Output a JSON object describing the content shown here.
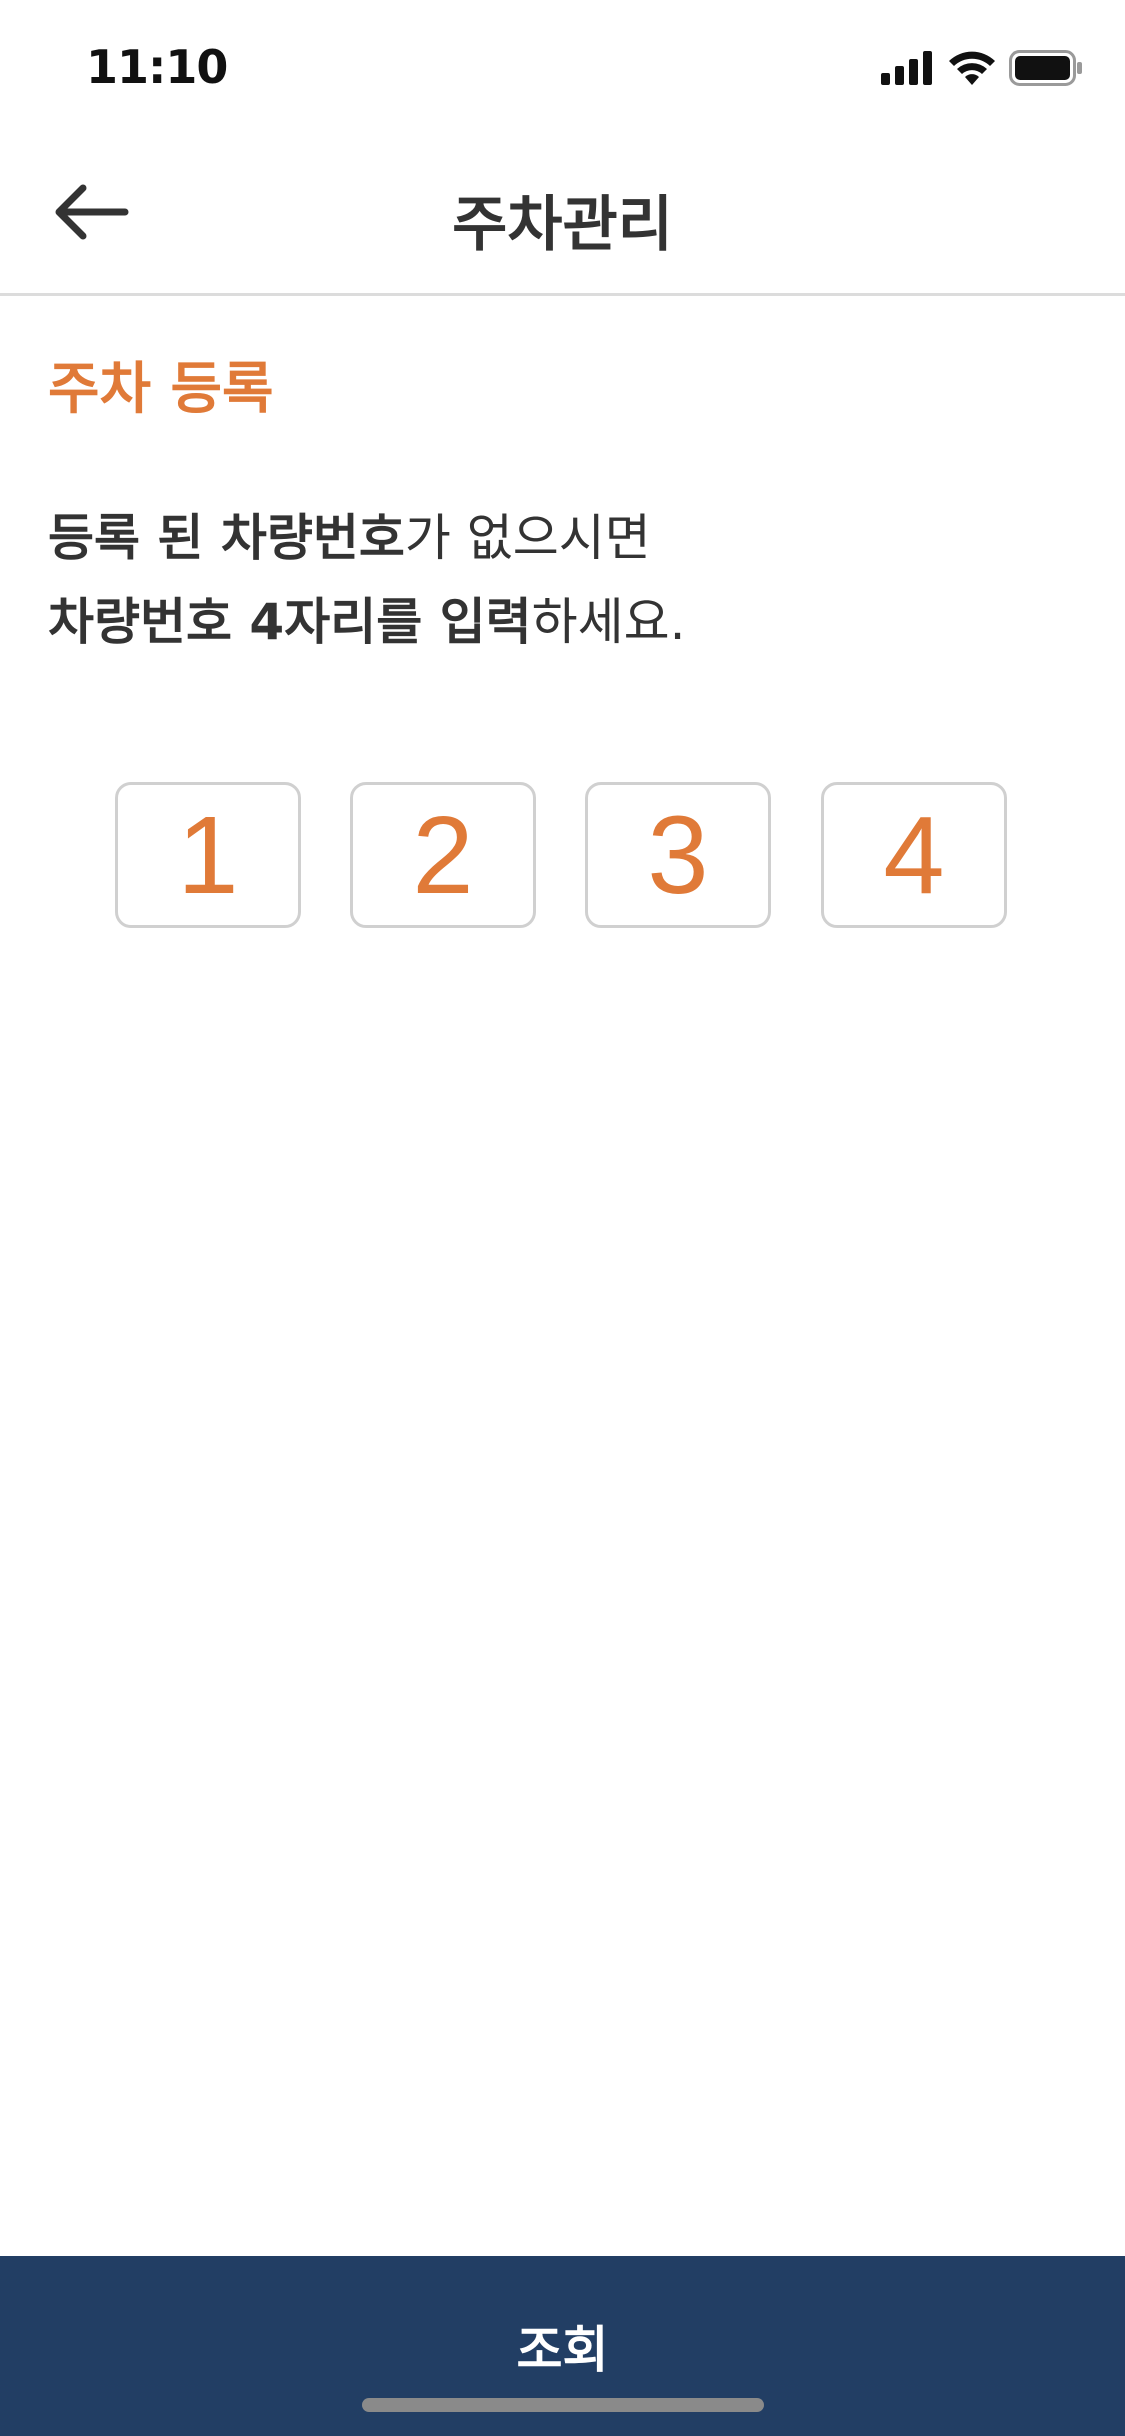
{
  "status_bar": {
    "time": "11:10",
    "icons": [
      "signal-icon",
      "wifi-icon",
      "battery-icon"
    ]
  },
  "header": {
    "title": "주차관리",
    "back_icon": "arrow-left-icon"
  },
  "section": {
    "title": "주차 등록"
  },
  "instructions": {
    "line1_bold": "등록 된 차량번호",
    "line1_rest": "가 없으시면",
    "line2_bold1": "차량번호 4자리를 ",
    "line2_bold2": "입력",
    "line2_rest": "하세요."
  },
  "plate_digits": [
    "1",
    "2",
    "3",
    "4"
  ],
  "bottom_button": {
    "label": "조회"
  },
  "colors": {
    "accent": "#e07a38",
    "button_bg": "#223e64",
    "text": "#333333",
    "border": "#d0d0d0"
  }
}
